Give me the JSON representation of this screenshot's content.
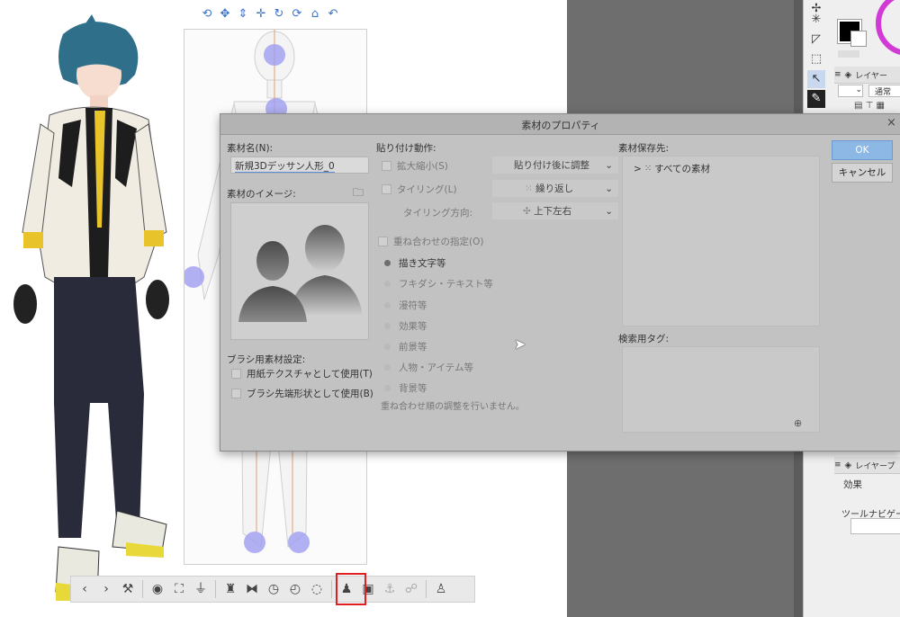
{
  "dialog": {
    "title": "素材のプロパティ",
    "close_glyph": "×",
    "name_label": "素材名(N):",
    "name_value": "新規3Dデッサン人形_0",
    "image_label": "素材のイメージ:",
    "brush_settings_label": "ブラシ用素材設定:",
    "brush_options": [
      "用紙テクスチャとして使用(T)",
      "ブラシ先端形状として使用(B)"
    ],
    "paste_section_label": "貼り付け動作:",
    "scale_label": "拡大縮小(S)",
    "scale_value": "貼り付け後に調整",
    "tiling_label": "タイリング(L)",
    "tiling_value": "繰り返し",
    "tiling_direction_label": "タイリング方向:",
    "tiling_direction_value": "上下左右",
    "overlay_label": "重ね合わせの指定(O)",
    "overlay_options": [
      "描き文字等",
      "フキダシ・テキスト等",
      "漫符等",
      "効果等",
      "前景等",
      "人物・アイテム等",
      "背景等"
    ],
    "overlay_note": "重ね合わせ順の調整を行いません。",
    "save_location_label": "素材保存先:",
    "tree_item": "すべての素材",
    "search_tag_label": "検索用タグ:",
    "ok_label": "OK",
    "cancel_label": "キャンセル"
  },
  "right_panel": {
    "layer_tab_label": "レイヤー",
    "blend_mode": "通常",
    "layer_prop_tab_label": "レイヤープ",
    "effect_label": "効果",
    "tool_navi_label": "ツールナビゲーシ"
  },
  "model_toolbar_icons": [
    "rotate-camera-icon",
    "pan-camera-icon",
    "dolly-camera-icon",
    "move-object-icon",
    "rotate-object-icon",
    "rotate-object-2-icon",
    "object-ground-icon",
    "undo-icon"
  ],
  "bottom_toolbar_icons": [
    "prev-icon",
    "next-icon",
    "wrench-icon",
    "camera-icon",
    "fit-icon",
    "ground-icon",
    "pose-icon",
    "flip-icon",
    "reset-pose-icon",
    "reset-object-icon",
    "reset-all-icon",
    "register-material-icon",
    "body-shape-icon",
    "fix-joint-icon",
    "unfix-joint-icon",
    "register-whole-icon"
  ],
  "colors": {
    "dialog_bg": "#c2c2c2",
    "accent": "#8db7e4",
    "highlight": "#e02020"
  }
}
